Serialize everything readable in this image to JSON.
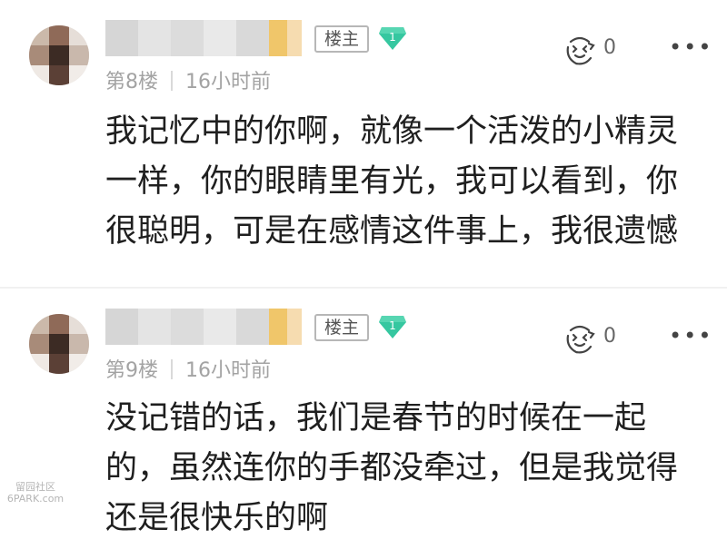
{
  "colors": {
    "badge_green": "#36c7a0",
    "meta_gray": "#a3a3a3",
    "text": "#1f1f1f"
  },
  "comments": [
    {
      "owner_tag": "楼主",
      "level": "1",
      "floor": "第8楼",
      "time": "16小时前",
      "like_icon": "like-face-icon",
      "like_count": "0",
      "more_icon": "more-dots-icon",
      "text": "我记忆中的你啊，就像一个活泼的小精灵一样，你的眼睛里有光，我可以看到，你很聪明，可是在感情这件事上，我很遗憾"
    },
    {
      "owner_tag": "楼主",
      "level": "1",
      "floor": "第9楼",
      "time": "16小时前",
      "like_icon": "like-face-icon",
      "like_count": "0",
      "more_icon": "more-dots-icon",
      "text": "没记错的话，我们是春节的时候在一起的，虽然连你的手都没牵过，但是我觉得还是很快乐的啊"
    }
  ],
  "watermark": {
    "line1": "留园社区",
    "line2": "6PARK.com"
  }
}
